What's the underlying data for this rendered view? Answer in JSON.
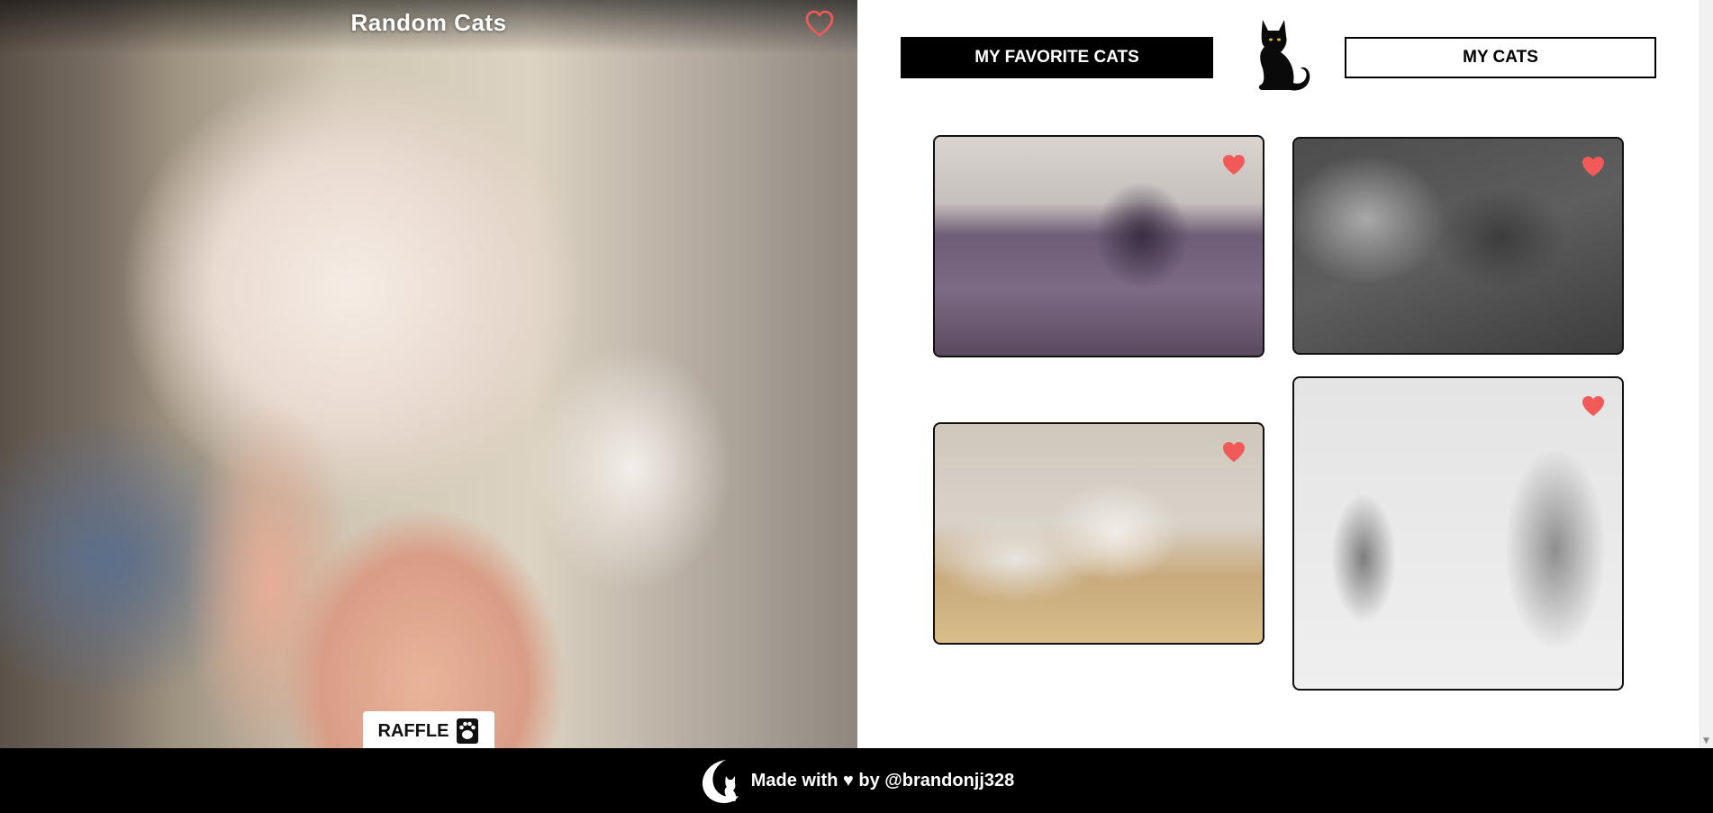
{
  "hero": {
    "title": "Random Cats",
    "favorite_icon": "heart-outline-icon",
    "raffle_label": "RAFFLE",
    "raffle_icon": "paw-icon"
  },
  "nav": {
    "favorites_label": "MY FAVORITE CATS",
    "my_cats_label": "MY CATS",
    "logo_icon": "cat-silhouette-icon"
  },
  "gallery": {
    "items": [
      {
        "alt": "kitten in purple garden",
        "favorite": true
      },
      {
        "alt": "grayscale kitten with hand",
        "favorite": true
      },
      {
        "alt": "calico kitten lying down",
        "favorite": true
      },
      {
        "alt": "two tabby kittens",
        "favorite": true
      }
    ]
  },
  "footer": {
    "text": "Made with ♥ by @brandonjj328",
    "logo_icon": "moon-cat-icon"
  },
  "colors": {
    "heart": "#f25a5a",
    "primary": "#000000",
    "background": "#ffffff"
  }
}
